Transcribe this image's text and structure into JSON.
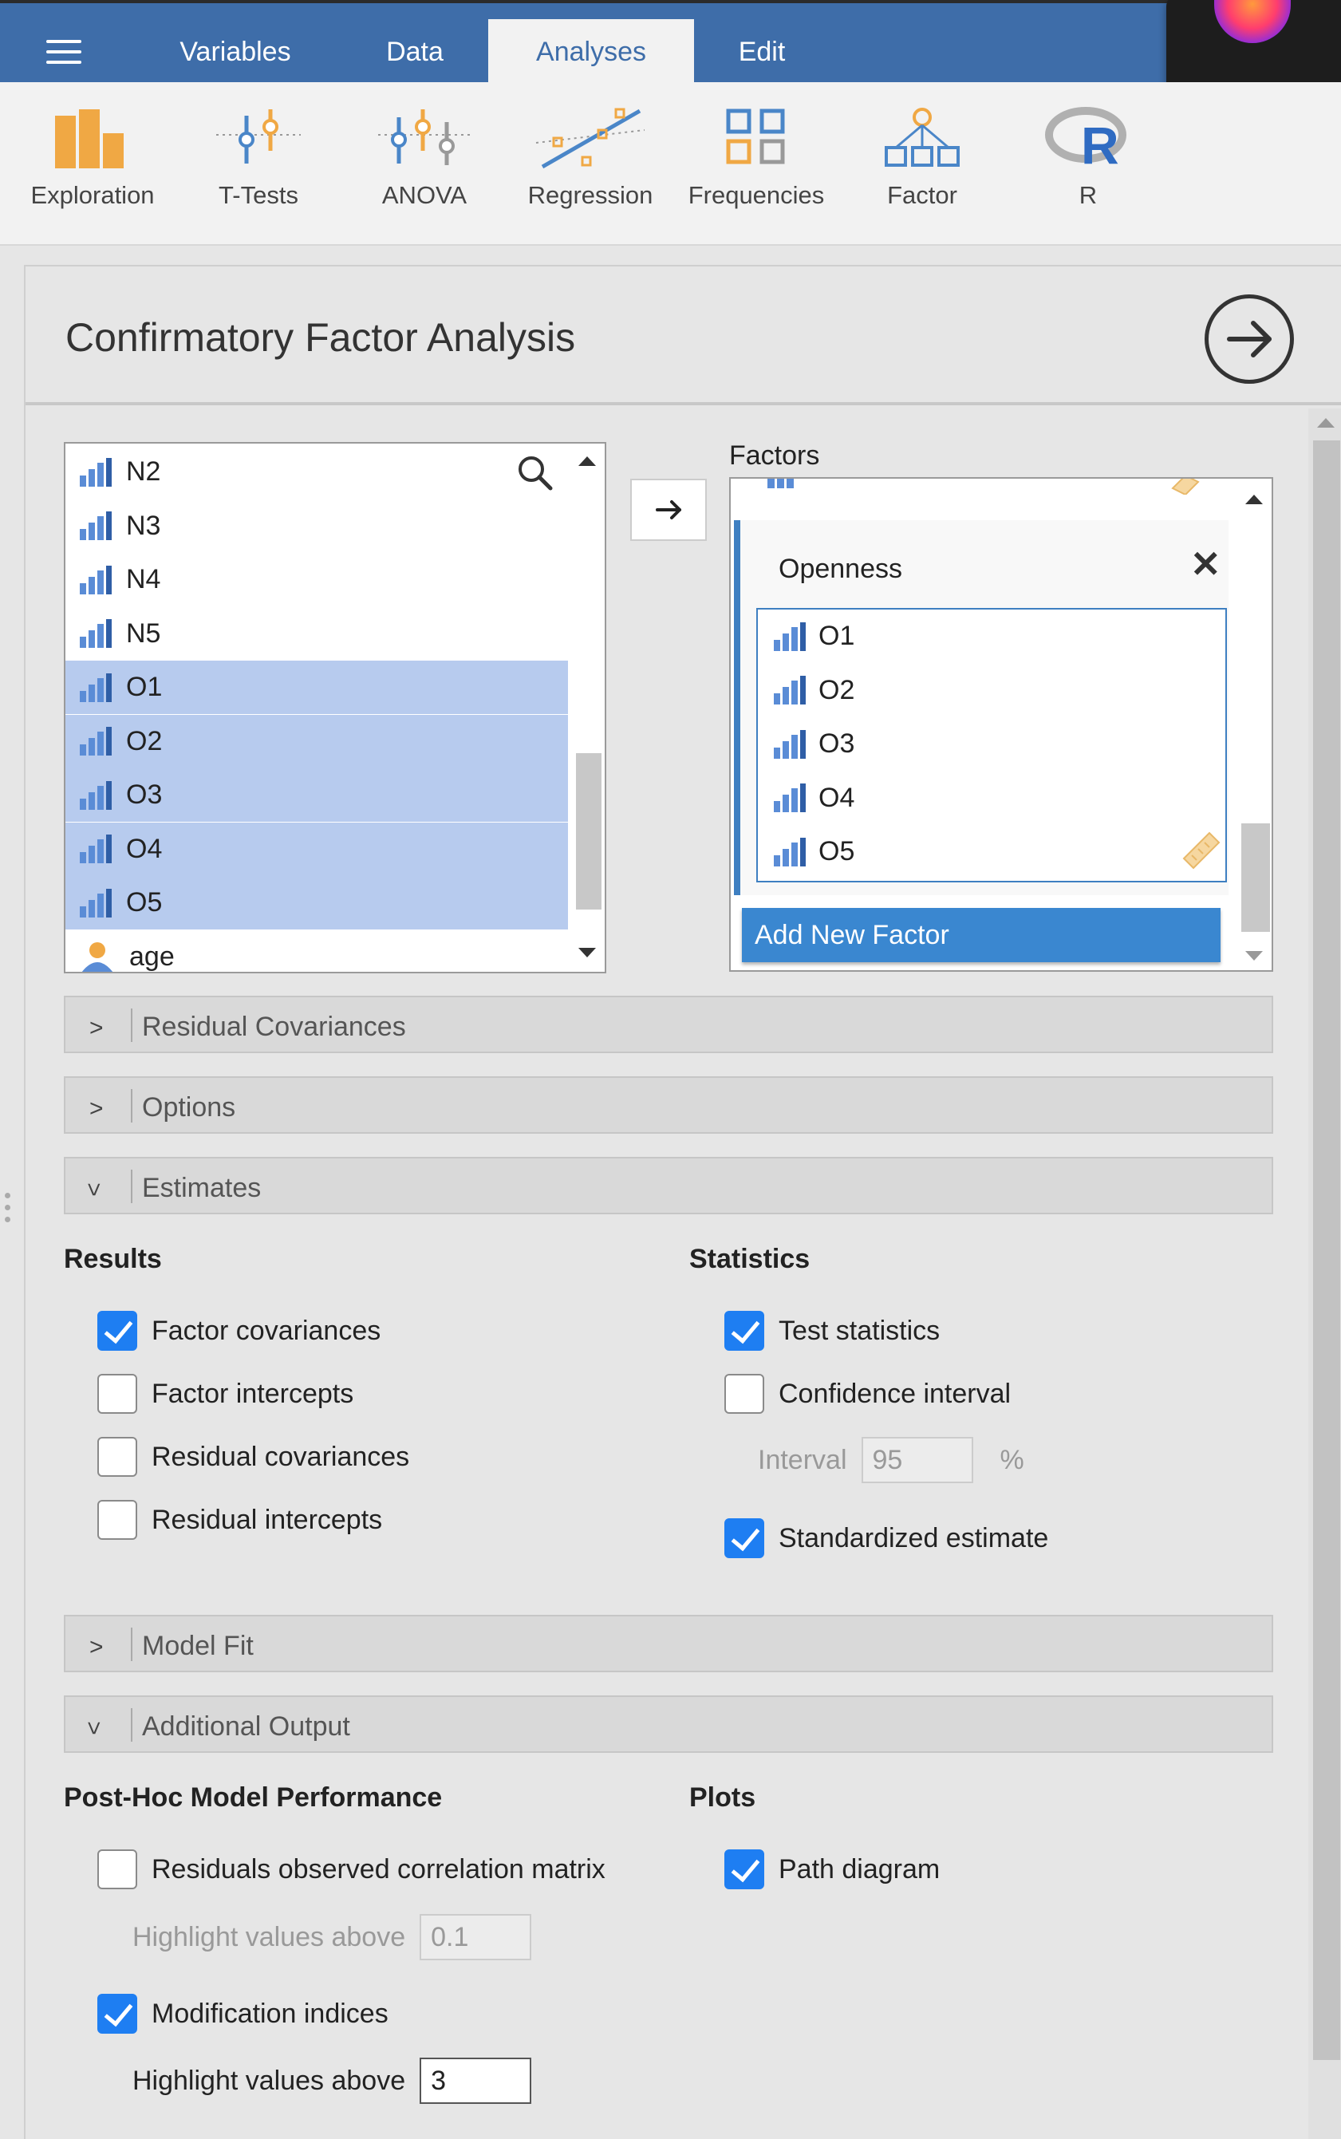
{
  "topbar": {
    "tabs": [
      {
        "label": "Variables",
        "active": false
      },
      {
        "label": "Data",
        "active": false
      },
      {
        "label": "Analyses",
        "active": true
      },
      {
        "label": "Edit",
        "active": false
      }
    ]
  },
  "ribbon": {
    "items": [
      {
        "label": "Exploration",
        "icon": "exploration-icon"
      },
      {
        "label": "T-Tests",
        "icon": "ttests-icon"
      },
      {
        "label": "ANOVA",
        "icon": "anova-icon"
      },
      {
        "label": "Regression",
        "icon": "regression-icon"
      },
      {
        "label": "Frequencies",
        "icon": "frequencies-icon"
      },
      {
        "label": "Factor",
        "icon": "factor-icon"
      },
      {
        "label": "R",
        "icon": "r-icon"
      }
    ]
  },
  "analysis": {
    "title": "Confirmatory Factor Analysis"
  },
  "variables": {
    "items": [
      {
        "label": "N2",
        "selected": false,
        "kind": "ordinal"
      },
      {
        "label": "N3",
        "selected": false,
        "kind": "ordinal"
      },
      {
        "label": "N4",
        "selected": false,
        "kind": "ordinal"
      },
      {
        "label": "N5",
        "selected": false,
        "kind": "ordinal"
      },
      {
        "label": "O1",
        "selected": true,
        "kind": "ordinal"
      },
      {
        "label": "O2",
        "selected": true,
        "kind": "ordinal"
      },
      {
        "label": "O3",
        "selected": true,
        "kind": "ordinal"
      },
      {
        "label": "O4",
        "selected": true,
        "kind": "ordinal"
      },
      {
        "label": "O5",
        "selected": true,
        "kind": "ordinal"
      },
      {
        "label": "age",
        "selected": false,
        "kind": "id"
      }
    ]
  },
  "factors": {
    "label": "Factors",
    "factor": {
      "name": "Openness",
      "vars": [
        "O1",
        "O2",
        "O3",
        "O4",
        "O5"
      ]
    },
    "add_button": "Add New Factor"
  },
  "sections": {
    "residual_covariances": "Residual Covariances",
    "options": "Options",
    "estimates": "Estimates",
    "model_fit": "Model Fit",
    "additional_output": "Additional Output"
  },
  "estimates": {
    "results_heading": "Results",
    "results": [
      {
        "label": "Factor covariances",
        "checked": true
      },
      {
        "label": "Factor intercepts",
        "checked": false
      },
      {
        "label": "Residual covariances",
        "checked": false
      },
      {
        "label": "Residual intercepts",
        "checked": false
      }
    ],
    "statistics_heading": "Statistics",
    "statistics": [
      {
        "label": "Test statistics",
        "checked": true
      },
      {
        "label": "Confidence interval",
        "checked": false
      }
    ],
    "interval_label": "Interval",
    "interval_value": "95",
    "interval_unit": "%",
    "standardized": {
      "label": "Standardized estimate",
      "checked": true
    }
  },
  "additional": {
    "posthoc_heading": "Post-Hoc Model Performance",
    "residuals_matrix": {
      "label": "Residuals observed correlation matrix",
      "checked": false
    },
    "highlight1_label": "Highlight values above",
    "highlight1_value": "0.1",
    "mod_indices": {
      "label": "Modification indices",
      "checked": true
    },
    "highlight2_label": "Highlight values above",
    "highlight2_value": "3",
    "plots_heading": "Plots",
    "path_diagram": {
      "label": "Path diagram",
      "checked": true
    }
  },
  "colors": {
    "topbar": "#3e6da9",
    "selection": "#b7cbee",
    "checkbox_on": "#1e7ef2",
    "add_button": "#3a87d0"
  }
}
